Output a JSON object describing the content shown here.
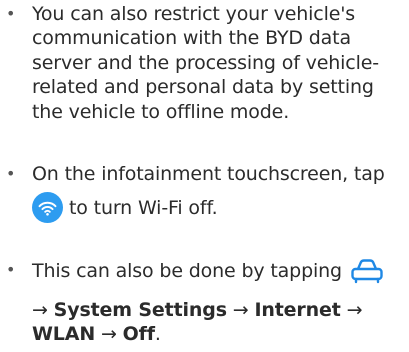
{
  "bullets": [
    {
      "lines": [
        "You can also restrict your vehicle's",
        "communication with the BYD data",
        "server and the processing of vehicle-",
        "related and personal data by setting",
        "the vehicle to offline mode."
      ]
    },
    {
      "line1": "On the infotainment touchscreen, tap",
      "icon": "wifi-icon",
      "line2_after_icon": "to turn Wi-Fi off."
    },
    {
      "line1": "This can also be done by tapping",
      "icon": "car-icon",
      "arrow": "→",
      "path": [
        "System Settings",
        "Internet",
        "WLAN",
        "Off"
      ],
      "end": "."
    }
  ],
  "colors": {
    "text": "#2b2b2b",
    "wifi_button": "#2d9cf0",
    "car_icon": "#1e88e5"
  }
}
